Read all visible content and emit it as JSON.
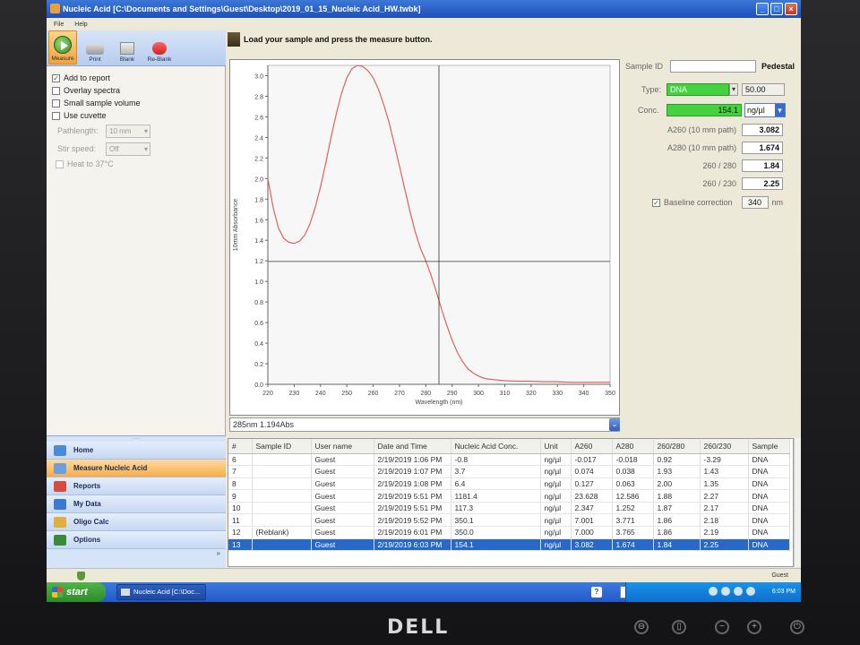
{
  "window": {
    "title": "Nucleic Acid  [C:\\Documents and Settings\\Guest\\Desktop\\2019_01_15_Nucleic Acid_HW.twbk]",
    "buttons": [
      "_",
      "□",
      "×"
    ]
  },
  "menu": [
    "File",
    "Help"
  ],
  "toolbar": [
    {
      "label": "Measure",
      "icon": "play-icon"
    },
    {
      "label": "Print",
      "icon": "printer-icon"
    },
    {
      "label": "Blank",
      "icon": "blank-icon"
    },
    {
      "label": "Re-Blank",
      "icon": "reblank-icon"
    }
  ],
  "options": {
    "add_to_report": "Add to report",
    "overlay_spectra": "Overlay spectra",
    "small_sample_volume": "Small sample volume",
    "use_cuvette": "Use cuvette",
    "pathlength_label": "Pathlength:",
    "pathlength_value": "10 mm",
    "stir_label": "Stir speed:",
    "stir_value": "Off",
    "heat": "Heat to 37°C",
    "add_to_report_checked": true
  },
  "message": "Load your sample and press the measure button.",
  "chart_data": {
    "type": "line",
    "xlabel": "Wavelength (nm)",
    "ylabel": "10mm Absorbance",
    "xlim": [
      220,
      350
    ],
    "ylim": [
      0.0,
      3.1
    ],
    "x_ticks": [
      "220",
      "230",
      "240",
      "250",
      "260",
      "270",
      "280",
      "290",
      "300",
      "310",
      "320",
      "330",
      "340",
      "350"
    ],
    "y_ticks": [
      "0.0",
      "0.2",
      "0.4",
      "0.6",
      "0.8",
      "1.0",
      "1.2",
      "1.4",
      "1.6",
      "1.8",
      "2.0",
      "2.2",
      "2.4",
      "2.6",
      "2.8",
      "3.0"
    ],
    "cursor": {
      "x": 285,
      "y": 1.194
    },
    "series": [
      {
        "color": "#e06060",
        "x": [
          220,
          222,
          224,
          226,
          228,
          230,
          232,
          234,
          236,
          238,
          240,
          242,
          244,
          246,
          248,
          250,
          252,
          254,
          256,
          258,
          260,
          262,
          264,
          266,
          268,
          270,
          272,
          274,
          276,
          278,
          280,
          282,
          284,
          286,
          288,
          290,
          292,
          294,
          296,
          298,
          300,
          302,
          304,
          306,
          308,
          310,
          315,
          320,
          325,
          330,
          335,
          340,
          345,
          350
        ],
        "y": [
          2.0,
          1.72,
          1.52,
          1.42,
          1.38,
          1.37,
          1.39,
          1.45,
          1.56,
          1.72,
          1.92,
          2.15,
          2.4,
          2.63,
          2.83,
          2.98,
          3.07,
          3.1,
          3.09,
          3.05,
          2.98,
          2.87,
          2.72,
          2.55,
          2.34,
          2.12,
          1.9,
          1.68,
          1.48,
          1.32,
          1.2,
          1.06,
          0.9,
          0.73,
          0.57,
          0.43,
          0.31,
          0.22,
          0.15,
          0.11,
          0.08,
          0.06,
          0.05,
          0.045,
          0.04,
          0.035,
          0.03,
          0.03,
          0.025,
          0.025,
          0.02,
          0.02,
          0.02,
          0.02
        ]
      }
    ]
  },
  "readout": "285nm 1.194Abs",
  "results": {
    "sample_id_label": "Sample ID",
    "sample_id_value": "",
    "pedestal": "Pedestal",
    "type_label": "Type:",
    "type_value": "DNA",
    "type_factor": "50.00",
    "conc_label": "Conc.",
    "conc_value": "154.1",
    "conc_unit": "ng/µl",
    "a260_label": "A260 (10 mm path)",
    "a260_value": "3.082",
    "a280_label": "A280 (10 mm path)",
    "a280_value": "1.674",
    "r260_280_label": "260 / 280",
    "r260_280_value": "1.84",
    "r260_230_label": "260 / 230",
    "r260_230_value": "2.25",
    "baseline_label": "Baseline correction",
    "baseline_value": "340",
    "baseline_unit": "nm"
  },
  "nav": [
    {
      "label": "Home",
      "color": "#4a8ad8"
    },
    {
      "label": "Measure Nucleic Acid",
      "color": "#6aa0e0",
      "active": true
    },
    {
      "label": "Reports",
      "color": "#d84a3a"
    },
    {
      "label": "My Data",
      "color": "#3a7ad0"
    },
    {
      "label": "Oligo Calc",
      "color": "#e0b03a"
    },
    {
      "label": "Options",
      "color": "#3a8a3a"
    }
  ],
  "nav_collapse": "»",
  "table": {
    "headers": [
      "#",
      "Sample ID",
      "User name",
      "Date and Time",
      "Nucleic Acid Conc.",
      "Unit",
      "A260",
      "A280",
      "260/280",
      "260/230",
      "Sample"
    ],
    "rows": [
      [
        "6",
        "",
        "Guest",
        "2/19/2019 1:06 PM",
        "-0.8",
        "ng/µl",
        "-0.017",
        "-0.018",
        "0.92",
        "-3.29",
        "DNA"
      ],
      [
        "7",
        "",
        "Guest",
        "2/19/2019 1:07 PM",
        "3.7",
        "ng/µl",
        "0.074",
        "0.038",
        "1.93",
        "1.43",
        "DNA"
      ],
      [
        "8",
        "",
        "Guest",
        "2/19/2019 1:08 PM",
        "6.4",
        "ng/µl",
        "0.127",
        "0.063",
        "2.00",
        "1.35",
        "DNA"
      ],
      [
        "9",
        "",
        "Guest",
        "2/19/2019 5:51 PM",
        "1181.4",
        "ng/µl",
        "23.628",
        "12.586",
        "1.88",
        "2.27",
        "DNA"
      ],
      [
        "10",
        "",
        "Guest",
        "2/19/2019 5:51 PM",
        "117.3",
        "ng/µl",
        "2.347",
        "1.252",
        "1.87",
        "2.17",
        "DNA"
      ],
      [
        "11",
        "",
        "Guest",
        "2/19/2019 5:52 PM",
        "350.1",
        "ng/µl",
        "7.001",
        "3.771",
        "1.86",
        "2.18",
        "DNA"
      ],
      [
        "12",
        "(Reblank)",
        "Guest",
        "2/19/2019 6:01 PM",
        "350.0",
        "ng/µl",
        "7.000",
        "3.765",
        "1.86",
        "2.19",
        "DNA"
      ],
      [
        "13",
        "",
        "Guest",
        "2/19/2019 6:03 PM",
        "154.1",
        "ng/µl",
        "3.082",
        "1.674",
        "1.84",
        "2.25",
        "DNA"
      ]
    ],
    "selected_row": 7
  },
  "status": {
    "user": "Guest"
  },
  "taskbar": {
    "start": "start",
    "item": "Nucleic Acid  [C:\\Doc...",
    "help": "?",
    "time": "6:03 PM"
  },
  "brand": "DELL",
  "monitor_buttons": [
    "⊖",
    "▯",
    "−",
    "+",
    "⏻"
  ]
}
